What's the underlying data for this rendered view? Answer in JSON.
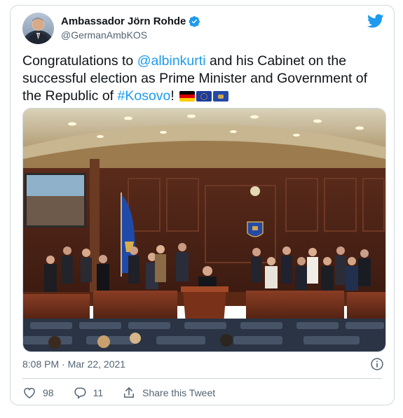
{
  "author": {
    "name": "Ambassador Jörn Rohde",
    "handle": "@GermanAmbKOS"
  },
  "tweet": {
    "text_before": "Congratulations to ",
    "mention": "@albinkurti",
    "text_middle": " and his Cabinet on the successful election as Prime Minister and Government of the Republic of ",
    "hashtag": "#Kosovo",
    "text_after": "!",
    "flags": [
      "germany-flag",
      "eu-flag",
      "kosovo-flag"
    ]
  },
  "timestamp": "8:08 PM · Mar 22, 2021",
  "actions": {
    "likes": "98",
    "replies": "11",
    "share_label": "Share this Tweet"
  },
  "colors": {
    "accent": "#1d9bf0",
    "text": "#0f1419",
    "muted": "#536471",
    "border": "#cfd9de"
  }
}
